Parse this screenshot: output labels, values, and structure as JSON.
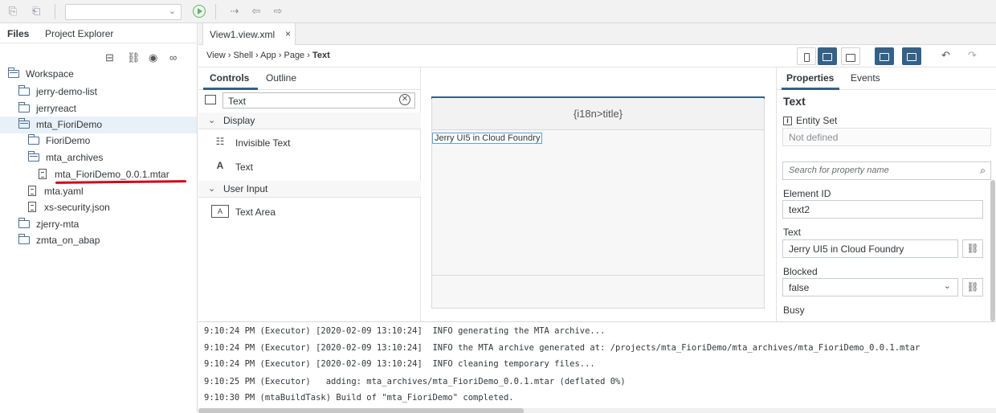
{
  "toolbar": {
    "project_select_value": ""
  },
  "explorer": {
    "tabs": [
      "Files",
      "Project Explorer"
    ],
    "tree": [
      {
        "label": "Workspace",
        "type": "folder-open"
      },
      {
        "label": "jerry-demo-list",
        "type": "folder"
      },
      {
        "label": "jerryreact",
        "type": "folder"
      },
      {
        "label": "mta_FioriDemo",
        "type": "folder-open",
        "selected": true
      },
      {
        "label": "FioriDemo",
        "type": "folder"
      },
      {
        "label": "mta_archives",
        "type": "folder-open"
      },
      {
        "label": "mta_FioriDemo_0.0.1.mtar",
        "type": "file"
      },
      {
        "label": "mta.yaml",
        "type": "file"
      },
      {
        "label": "xs-security.json",
        "type": "file"
      },
      {
        "label": "zjerry-mta",
        "type": "folder"
      },
      {
        "label": "zmta_on_abap",
        "type": "folder"
      }
    ]
  },
  "editor": {
    "tab_label": "View1.view.xml",
    "tab_close": "×",
    "breadcrumb": [
      "View",
      "Shell",
      "App",
      "Page",
      "Text"
    ],
    "breadcrumb_sep": "›"
  },
  "controls": {
    "tabs": [
      "Controls",
      "Outline"
    ],
    "search_value": "Text",
    "groups": [
      {
        "label": "Display",
        "items": [
          {
            "label": "Invisible Text",
            "icon": "invisible-text-icon"
          },
          {
            "label": "Text",
            "icon": "text-icon",
            "glyph": "A"
          }
        ]
      },
      {
        "label": "User Input",
        "items": [
          {
            "label": "Text Area",
            "icon": "text-area-icon",
            "glyph": "A"
          }
        ]
      }
    ]
  },
  "canvas": {
    "header_title": "{i18n>title}",
    "text_control": "Jerry UI5 in Cloud Foundry"
  },
  "properties": {
    "tabs": [
      "Properties",
      "Events"
    ],
    "control_name": "Text",
    "entity_set_label": "Entity Set",
    "entity_set_value": "Not defined",
    "search_placeholder": "Search for property name",
    "element_id_label": "Element ID",
    "element_id_value": "text2",
    "text_label": "Text",
    "text_value": "Jerry UI5 in Cloud Foundry",
    "blocked_label": "Blocked",
    "blocked_value": "false",
    "busy_label": "Busy"
  },
  "console": {
    "lines": [
      "9:10:24 PM (Executor) [2020-02-09 13:10:24]  INFO generating the MTA archive...",
      "9:10:24 PM (Executor) [2020-02-09 13:10:24]  INFO the MTA archive generated at: /projects/mta_FioriDemo/mta_archives/mta_FioriDemo_0.0.1.mtar",
      "9:10:24 PM (Executor) [2020-02-09 13:10:24]  INFO cleaning temporary files...",
      "9:10:25 PM (Executor)   adding: mta_archives/mta_FioriDemo_0.0.1.mtar (deflated 0%)",
      "9:10:30 PM (mtaBuildTask) Build of \"mta_FioriDemo\" completed."
    ]
  },
  "colors": {
    "accent": "#346187",
    "annotation_underline": "#d0021b",
    "run_green": "#5cb85c"
  }
}
